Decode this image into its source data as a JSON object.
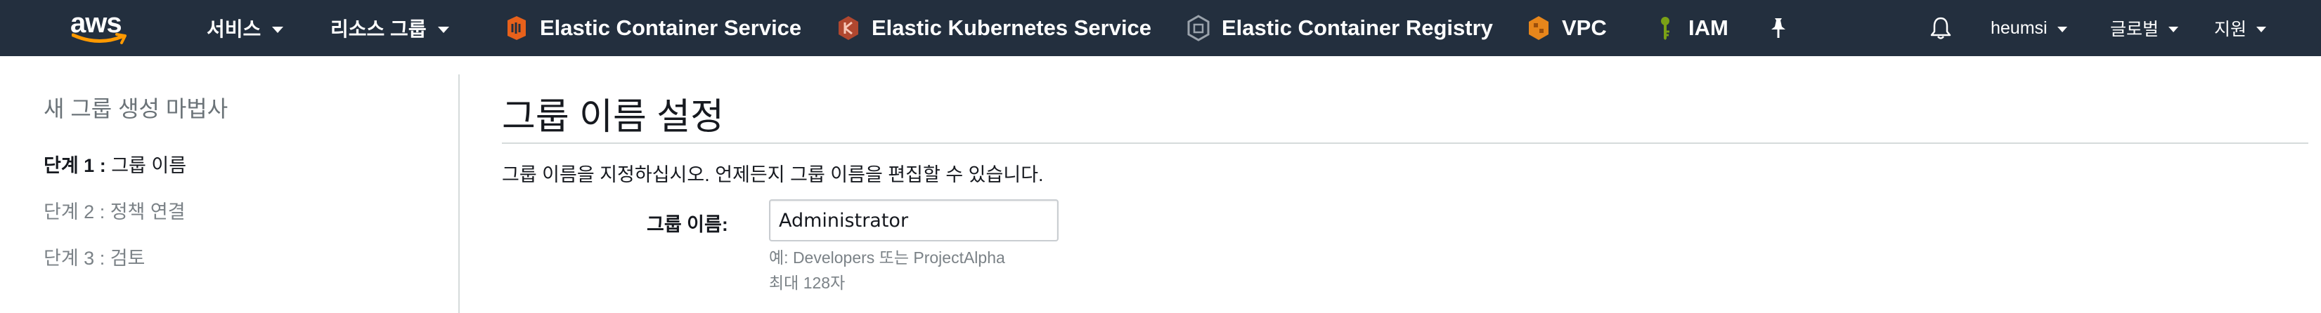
{
  "topnav": {
    "logo_text": "aws",
    "services_label": "서비스",
    "resource_groups_label": "리소스 그룹",
    "shortcuts": [
      {
        "label": "Elastic Container Service",
        "icon": "ecs-icon",
        "color": "#e7611b"
      },
      {
        "label": "Elastic Kubernetes Service",
        "icon": "eks-icon",
        "color": "#b0472f"
      },
      {
        "label": "Elastic Container Registry",
        "icon": "ecr-icon",
        "color": "#9aa2ab"
      },
      {
        "label": "VPC",
        "icon": "vpc-icon",
        "color": "#e7861b"
      },
      {
        "label": "IAM",
        "icon": "iam-key-icon",
        "color": "#7aa116"
      }
    ],
    "pin_icon": "pushpin-icon",
    "bell_icon": "bell-icon",
    "user_label": "heumsi",
    "region_label": "글로벌",
    "support_label": "지원"
  },
  "sidebar": {
    "title": "새 그룹 생성 마법사",
    "steps": [
      {
        "number": "단계 1",
        "separator": " : ",
        "name": "그룹 이름",
        "active": true
      },
      {
        "number": "단계 2",
        "separator": " : ",
        "name": "정책 연결",
        "active": false
      },
      {
        "number": "단계 3",
        "separator": " : ",
        "name": "검토",
        "active": false
      }
    ]
  },
  "main": {
    "title": "그룹 이름 설정",
    "instructions": "그룹 이름을 지정하십시오. 언제든지 그룹 이름을 편집할 수 있습니다.",
    "field_label": "그룹 이름:",
    "group_name_value": "Administrator",
    "hint_example": "예: Developers 또는 ProjectAlpha",
    "hint_max": "최대 128자"
  },
  "colors": {
    "nav_background": "#232f3e",
    "aws_smile": "#ff9900",
    "divider": "#d5dbdb"
  }
}
